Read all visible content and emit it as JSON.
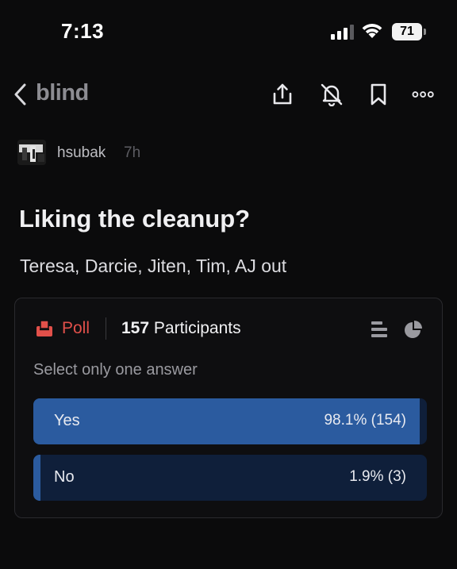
{
  "status_bar": {
    "time": "7:13",
    "battery": "71"
  },
  "nav": {
    "brand": "blind",
    "icons": [
      "chevron-left-icon",
      "share-icon",
      "bell-off-icon",
      "bookmark-icon",
      "more-icon"
    ]
  },
  "post": {
    "author": "hsubak",
    "time": "7h",
    "title": "Liking the cleanup?",
    "body": "Teresa, Darcie, Jiten, Tim, AJ out"
  },
  "poll": {
    "label": "Poll",
    "participants_count": "157",
    "participants_label": "Participants",
    "instruction": "Select only one answer",
    "accent_color": "#e2504a",
    "options": [
      {
        "label": "Yes",
        "result": "98.1% (154)",
        "percent": 98.1
      },
      {
        "label": "No",
        "result": "1.9% (3)",
        "percent": 1.9
      }
    ]
  }
}
